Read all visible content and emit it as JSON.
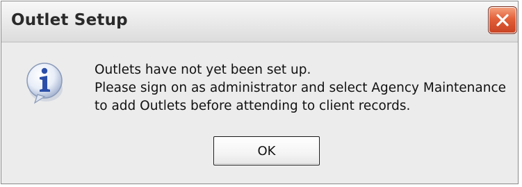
{
  "dialog": {
    "title": "Outlet Setup",
    "close_icon": "close-x-icon",
    "icon": "info-icon",
    "message_lines": [
      "Outlets have not yet been set up.",
      "Please sign on as administrator and select Agency Maintenance",
      "to add Outlets before attending to client records."
    ],
    "ok_label": "OK"
  },
  "colors": {
    "close_button": "#e2603a",
    "dialog_background": "#ececec",
    "info_icon_accent": "#2b4fa8"
  }
}
